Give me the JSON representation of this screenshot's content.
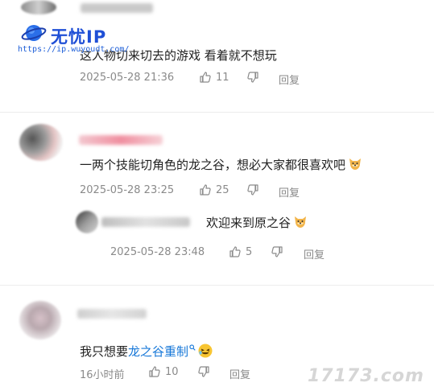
{
  "watermark": {
    "title": "无忧IP",
    "url": "https://ip.wuyoudt.com/",
    "corner": "17173.com"
  },
  "comments": [
    {
      "text": "这人物切来切去的游戏 看着就不想玩",
      "time": "2025-05-28 21:36",
      "likes": "11",
      "reply_label": "回复"
    },
    {
      "text": "一两个技能切角色的龙之谷，想必大家都很喜欢吧",
      "time": "2025-05-28 23:25",
      "likes": "25",
      "reply_label": "回复",
      "reply": {
        "text": "欢迎来到原之谷",
        "time": "2025-05-28 23:48",
        "likes": "5",
        "reply_label": "回复"
      }
    },
    {
      "text_prefix": "我只想要",
      "text_link": "龙之谷重制",
      "time": "16小时前",
      "likes": "10",
      "reply_label": "回复"
    }
  ],
  "colors": {
    "link": "#1677d8",
    "meta": "#8a8a8a",
    "text": "#1f1f1f",
    "divider": "#ececec"
  }
}
